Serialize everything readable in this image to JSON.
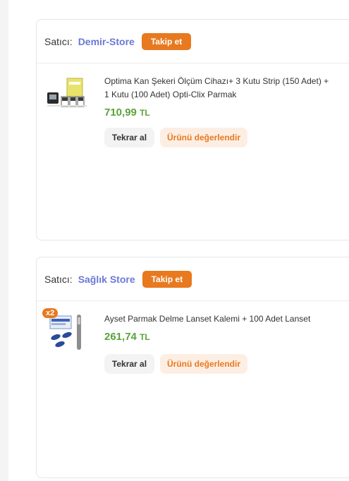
{
  "orders": [
    {
      "seller_label": "Satıcı:",
      "seller_name": "Demir-Store",
      "follow_label": "Takip et",
      "product_title": "Optima Kan Şekeri Ölçüm Cihazı+ 3 Kutu Strip (150 Adet) + 1 Kutu (100 Adet) Opti-Clix Parmak",
      "price_value": "710,99",
      "price_currency": "TL",
      "buy_again_label": "Tekrar al",
      "review_label": "Ürünü değerlendir",
      "quantity_badge": ""
    },
    {
      "seller_label": "Satıcı:",
      "seller_name": "Sağlık Store",
      "follow_label": "Takip et",
      "product_title": "Ayset Parmak Delme Lanset Kalemi + 100 Adet Lanset",
      "price_value": "261,74",
      "price_currency": "TL",
      "buy_again_label": "Tekrar al",
      "review_label": "Ürünü değerlendir",
      "quantity_badge": "x2"
    }
  ],
  "colors": {
    "accent_orange": "#e8791f",
    "seller_link": "#6b78d6",
    "price_green": "#5aa33b"
  }
}
